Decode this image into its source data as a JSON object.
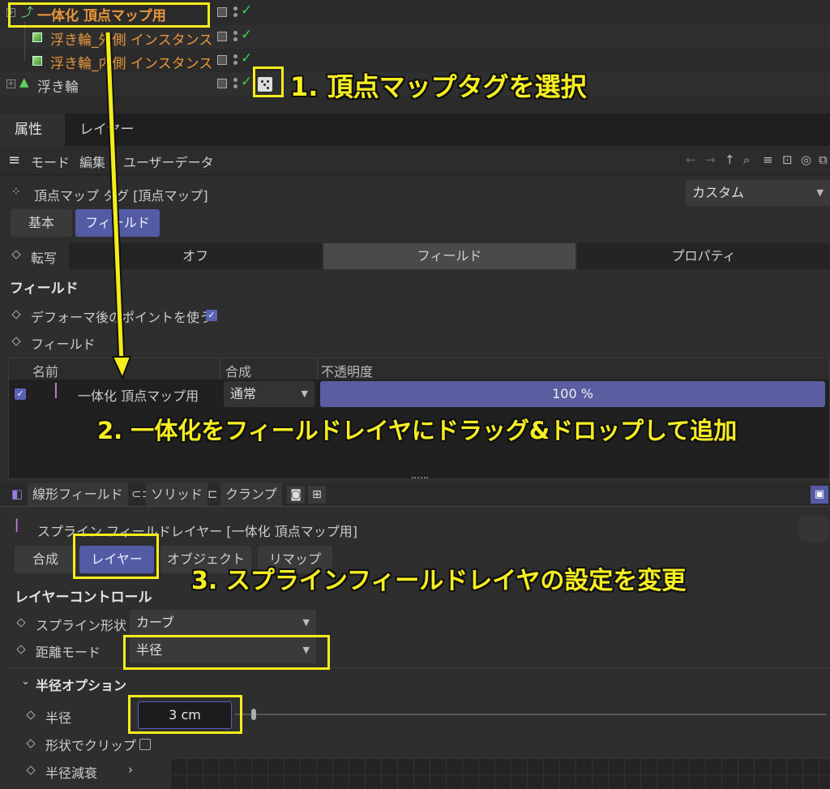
{
  "object_manager": {
    "rows": [
      {
        "name": "一体化 頂点マップ用"
      },
      {
        "name": "浮き輪_外側 インスタンス"
      },
      {
        "name": "浮き輪_内側 インスタンス"
      },
      {
        "name": "浮き輪"
      }
    ]
  },
  "annotations": {
    "step1": "1. 頂点マップタグを選択",
    "step2": "2. 一体化をフィールドレイヤにドラッグ&ドロップして追加",
    "step3": "3. スプラインフィールドレイヤの設定を変更"
  },
  "tabs": [
    "属性",
    "レイヤー"
  ],
  "menu": [
    "モード",
    "編集",
    "ユーザーデータ"
  ],
  "tag_header": {
    "title": "頂点マップ タグ [頂点マップ]",
    "preset": "カスタム"
  },
  "subtabs": [
    "基本",
    "フィールド"
  ],
  "transfer": {
    "label": "転写",
    "options": [
      "オフ",
      "フィールド",
      "プロパティ"
    ],
    "selected": "フィールド"
  },
  "field_section": {
    "title": "フィールド",
    "use_deformed_label": "デフォーマ後のポイントを使う",
    "fields_label": "フィールド"
  },
  "field_list": {
    "columns": [
      "名前",
      "合成",
      "不透明度"
    ],
    "rows": [
      {
        "name": "一体化 頂点マップ用",
        "blend": "通常",
        "opacity": "100 %"
      }
    ]
  },
  "sub_toolbar": [
    "線形フィールド",
    "ソリッド",
    "クランプ"
  ],
  "layer_header": {
    "title": "スプライン フィールドレイヤー [一体化 頂点マップ用]"
  },
  "layer_tabs": [
    "合成",
    "レイヤー",
    "オブジェクト",
    "リマップ"
  ],
  "layer_control": {
    "title": "レイヤーコントロール",
    "spline_shape_label": "スプライン形状",
    "spline_shape_value": "カーブ",
    "distance_mode_label": "距離モード",
    "distance_mode_value": "半径"
  },
  "radius_options": {
    "title": "半径オプション",
    "radius_label": "半径",
    "radius_value": "3 cm",
    "clip_label": "形状でクリップ",
    "falloff_label": "半径減衰"
  }
}
